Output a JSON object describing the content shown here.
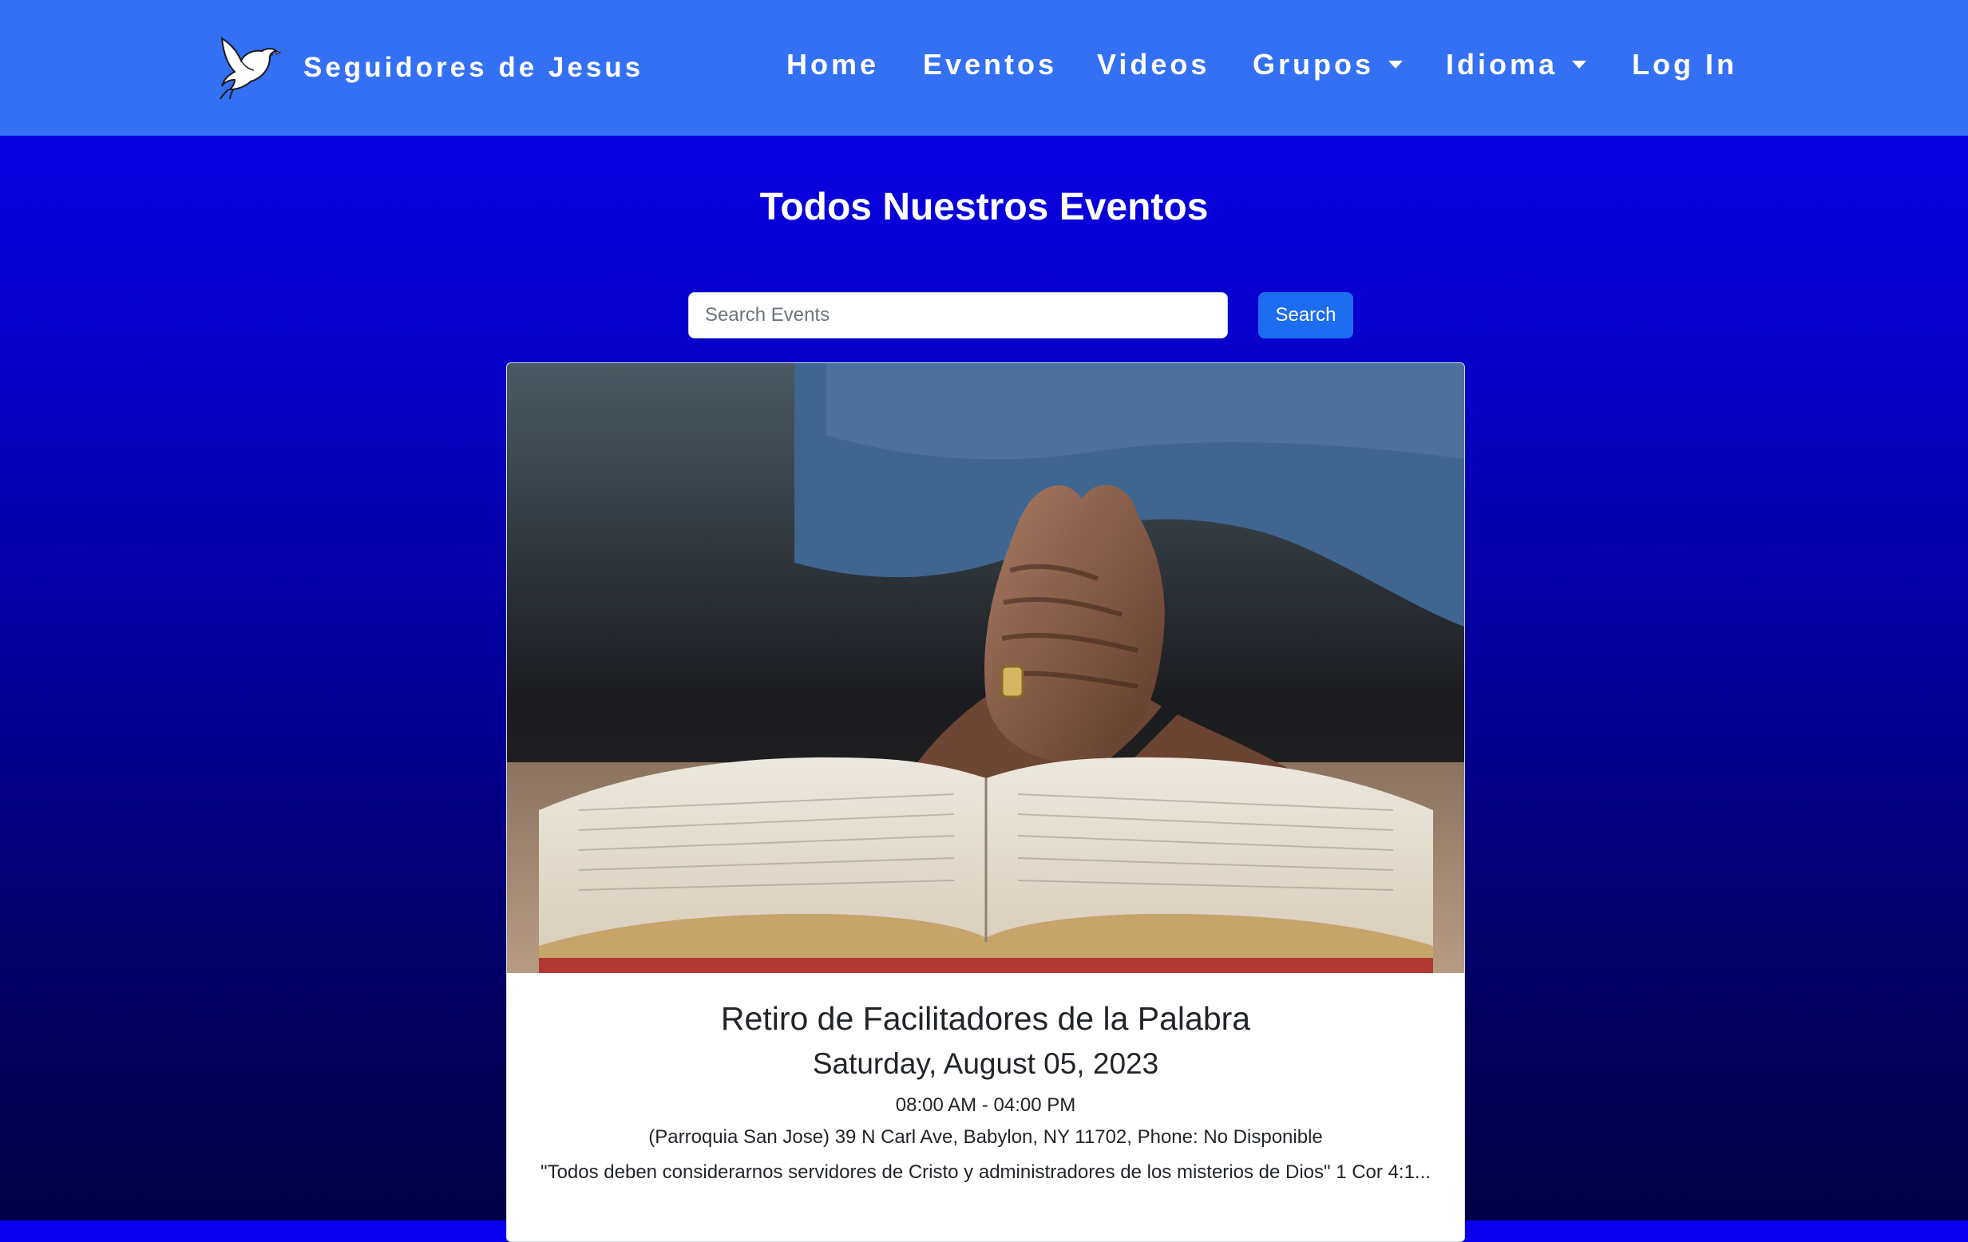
{
  "navbar": {
    "brand_name": "Seguidores de Jesus",
    "brand_logo_icon": "dove-icon",
    "items": [
      {
        "label": "Home",
        "dropdown": false
      },
      {
        "label": "Eventos",
        "dropdown": false
      },
      {
        "label": "Videos",
        "dropdown": false
      },
      {
        "label": "Grupos",
        "dropdown": true
      },
      {
        "label": "Idioma",
        "dropdown": true
      },
      {
        "label": "Log In",
        "dropdown": false
      }
    ]
  },
  "page": {
    "title": "Todos Nuestros Eventos"
  },
  "search": {
    "placeholder": "Search Events",
    "value": "",
    "button_label": "Search"
  },
  "events": [
    {
      "image_icon": "praying-hands-bible-photo",
      "title": "Retiro de Facilitadores de la Palabra",
      "date": "Saturday, August 05, 2023",
      "time": "08:00 AM - 04:00 PM",
      "location": "(Parroquia San Jose) 39 N Carl Ave, Babylon, NY 11702, Phone: No Disponible",
      "description": "\"Todos deben considerarnos servidores de Cristo y administradores de los misterios de Dios\" 1 Cor 4:1..."
    }
  ],
  "colors": {
    "navbar_bg": "#3370f3",
    "page_bg_top": "#0a00f0",
    "page_bg_bottom": "#010045",
    "search_button": "#1d6df0"
  }
}
